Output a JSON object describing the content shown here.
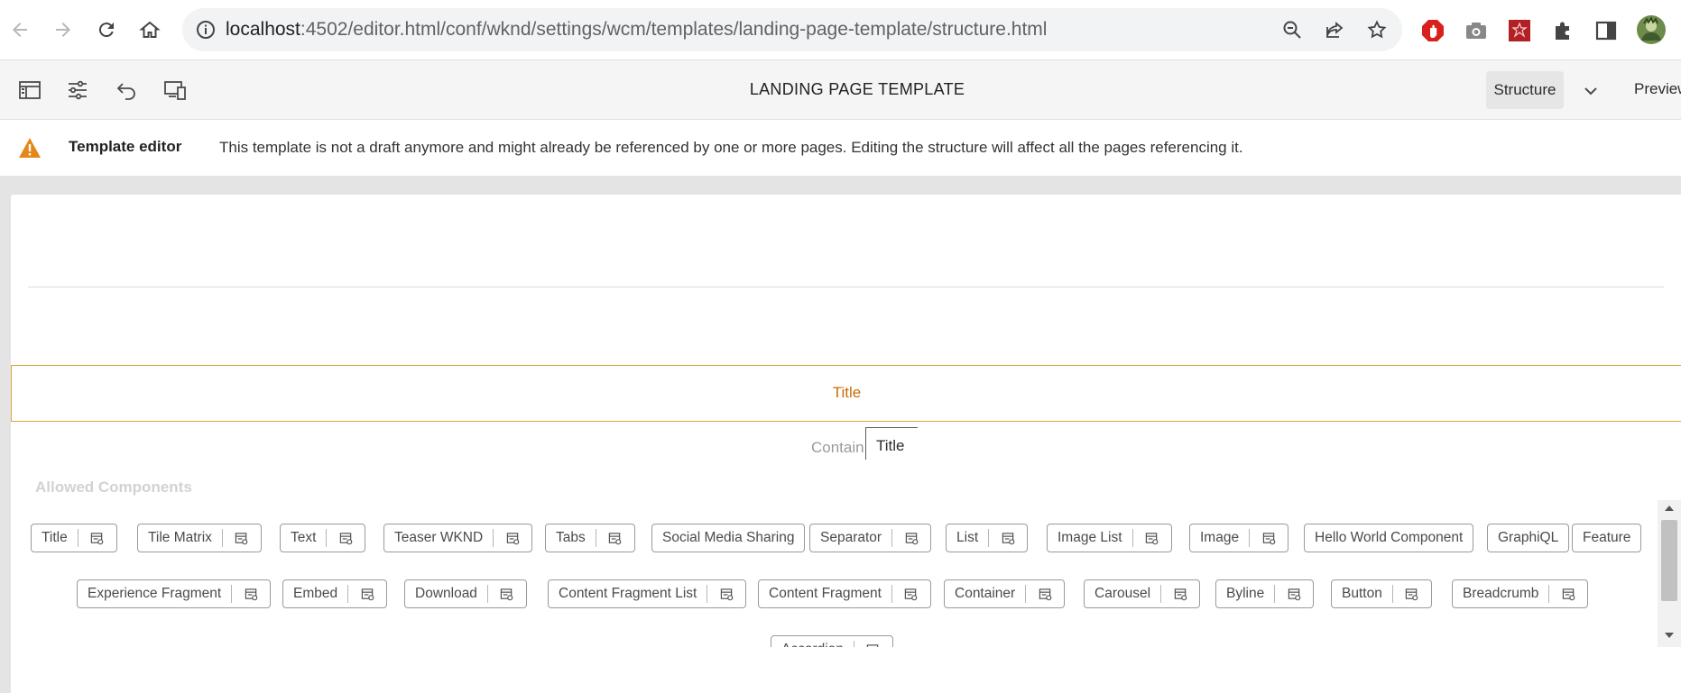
{
  "browser": {
    "url_host": "localhost",
    "url_path": ":4502/editor.html/conf/wknd/settings/wcm/templates/landing-page-template/structure.html"
  },
  "toolbar": {
    "title": "LANDING PAGE TEMPLATE",
    "mode": "Structure",
    "preview": "Preview",
    "icons": [
      "side-panel-icon",
      "page-properties-icon",
      "undo-icon",
      "emulator-icon"
    ]
  },
  "alert": {
    "title": "Template editor",
    "message": "This template is not a draft anymore and might already be referenced by one or more pages. Editing the structure will affect all the pages referencing it."
  },
  "canvas": {
    "title_component_label": "Title",
    "container_label": "Contain",
    "tooltip": "Title",
    "allowed_heading": "Allowed Components"
  },
  "components": {
    "row1": [
      {
        "label": "Title",
        "config": true
      },
      {
        "label": "Tile Matrix",
        "config": true
      },
      {
        "label": "Text",
        "config": true
      },
      {
        "label": "Teaser WKND",
        "config": true
      },
      {
        "label": "Tabs",
        "config": true
      },
      {
        "label": "Social Media Sharing",
        "config": false
      },
      {
        "label": "Separator",
        "config": true
      },
      {
        "label": "List",
        "config": true
      },
      {
        "label": "Image List",
        "config": true
      },
      {
        "label": "Image",
        "config": true
      },
      {
        "label": "Hello World Component",
        "config": false
      },
      {
        "label": "GraphiQL",
        "config": false
      },
      {
        "label": "Feature",
        "config": false
      }
    ],
    "row2": [
      {
        "label": "Experience Fragment",
        "config": true
      },
      {
        "label": "Embed",
        "config": true
      },
      {
        "label": "Download",
        "config": true
      },
      {
        "label": "Content Fragment List",
        "config": true
      },
      {
        "label": "Content Fragment",
        "config": true
      },
      {
        "label": "Container",
        "config": true
      },
      {
        "label": "Carousel",
        "config": true
      },
      {
        "label": "Byline",
        "config": true
      },
      {
        "label": "Button",
        "config": true
      },
      {
        "label": "Breadcrumb",
        "config": true
      }
    ],
    "row3": [
      {
        "label": "Accordion",
        "config": true
      }
    ]
  },
  "colors": {
    "accent_orange": "#c86c06",
    "frame_border": "#d6a73b",
    "warning": "#e68619"
  }
}
